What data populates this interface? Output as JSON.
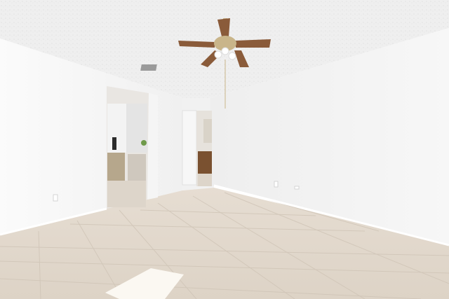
{
  "scene": {
    "description_type": "photo",
    "colors": {
      "ceiling": "#efefef",
      "wall_left": "#f7f7f7",
      "wall_back": "#f1f1f1",
      "wall_right": "#f4f4f4",
      "floor": "#e7ddd1",
      "baseboard": "#ffffff",
      "fan_blade": "#8a5b3a",
      "fan_metal": "#c9b58a",
      "doorway_dark": "#cfc9c2",
      "cabinet": "#7a5130"
    }
  }
}
